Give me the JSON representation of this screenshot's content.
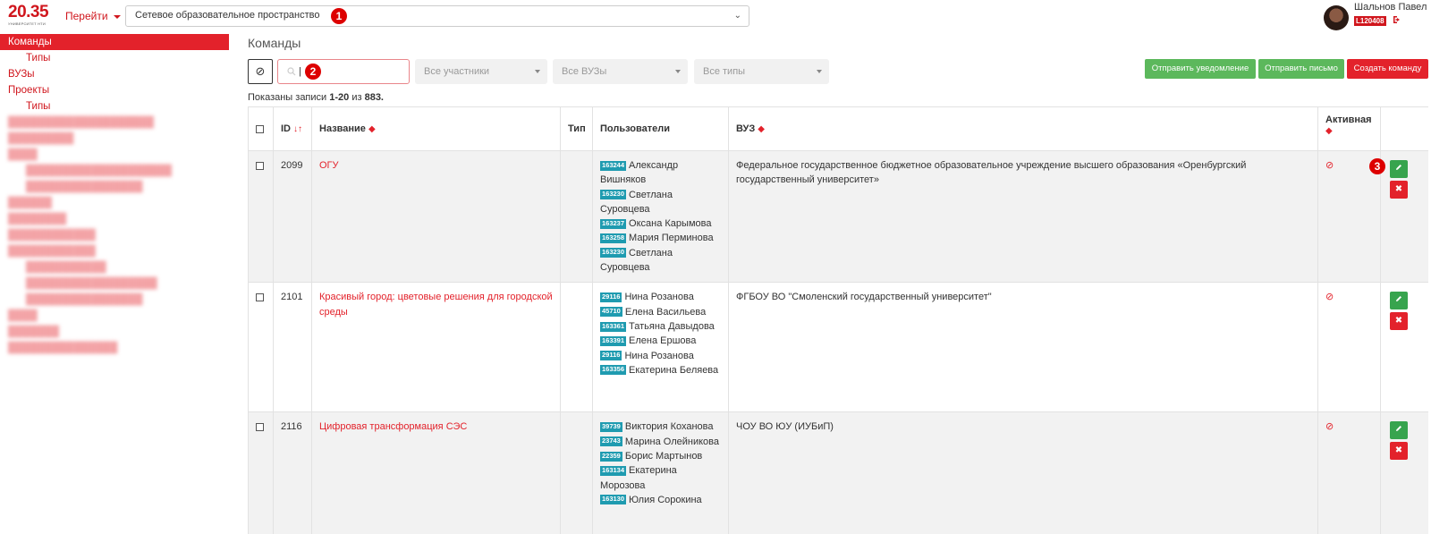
{
  "header": {
    "logo_number": "20.35",
    "logo_sub": "УНИВЕРСИТЕТ НТИ",
    "goto_label": "Перейти",
    "space_select_value": "Сетевое образовательное пространство",
    "user_name": "Шальнов Павел",
    "user_id": "L120408"
  },
  "markers": [
    "1",
    "2",
    "3"
  ],
  "sidebar": {
    "items": [
      {
        "label": "Команды",
        "active": true,
        "level": 0
      },
      {
        "label": "Типы",
        "level": 1
      },
      {
        "label": "ВУЗы",
        "level": 0
      },
      {
        "label": "Проекты",
        "level": 0
      },
      {
        "label": "Типы",
        "level": 1
      }
    ]
  },
  "main": {
    "title": "Команды",
    "search_placeholder": "|",
    "filter_participants": "Все участники",
    "filter_universities": "Все ВУЗы",
    "filter_types": "Все типы",
    "btn_notify": "Отправить уведомление",
    "btn_letter": "Отправить письмо",
    "btn_create": "Создать команду",
    "records_prefix": "Показаны записи ",
    "records_range": "1-20",
    "records_mid": " из ",
    "records_total": "883."
  },
  "table": {
    "headers": {
      "id": "ID",
      "name": "Название",
      "type": "Тип",
      "users": "Пользователи",
      "university": "ВУЗ",
      "active": "Активная"
    },
    "rows": [
      {
        "id": "2099",
        "name": "ОГУ",
        "type": "",
        "users": [
          {
            "uid": "163244",
            "name": "Александр Вишняков"
          },
          {
            "uid": "163230",
            "name": "Светлана Суровцева"
          },
          {
            "uid": "163237",
            "name": "Оксана Карымова"
          },
          {
            "uid": "163258",
            "name": "Мария Перминова"
          },
          {
            "uid": "163230",
            "name": "Светлана Суровцева"
          }
        ],
        "university": "Федеральное государственное бюджетное образовательное учреждение высшего образования «Оренбургский государственный университет»"
      },
      {
        "id": "2101",
        "name": "Красивый город: цветовые решения для городской среды",
        "type": "",
        "users": [
          {
            "uid": "29116",
            "name": "Нина Розанова"
          },
          {
            "uid": "45710",
            "name": "Елена Васильева"
          },
          {
            "uid": "163361",
            "name": "Татьяна Давыдова"
          },
          {
            "uid": "163391",
            "name": "Елена Ершова"
          },
          {
            "uid": "29116",
            "name": "Нина Розанова"
          },
          {
            "uid": "163356",
            "name": "Екатерина Беляева"
          }
        ],
        "university": "ФГБОУ ВО \"Смоленский государственный университет\""
      },
      {
        "id": "2116",
        "name": "Цифровая трансформация СЭС",
        "type": "",
        "users": [
          {
            "uid": "39739",
            "name": "Виктория Коханова"
          },
          {
            "uid": "23743",
            "name": "Марина Олейникова"
          },
          {
            "uid": "22359",
            "name": "Борис Мартынов"
          },
          {
            "uid": "163134",
            "name": "Екатерина Морозова"
          },
          {
            "uid": "163130",
            "name": "Юлия Сорокина"
          }
        ],
        "university": "ЧОУ ВО ЮУ (ИУБиП)"
      }
    ]
  },
  "colors": {
    "brand_red": "#e3222b",
    "green": "#5cb85c",
    "uid_badge": "#1f9bb0"
  },
  "icons": {
    "reset": "ban-icon",
    "search": "search-icon",
    "edit": "pencil-icon",
    "delete": "close-icon",
    "inactive": "ban-icon",
    "logout": "logout-icon"
  }
}
